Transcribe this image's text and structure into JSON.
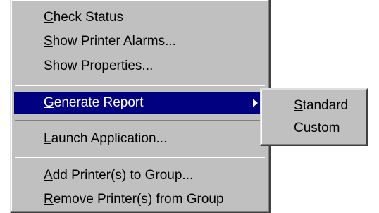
{
  "context_menu": {
    "items": [
      {
        "label": "Check Status",
        "accel": "C"
      },
      {
        "label": "Show Printer Alarms...",
        "accel": "S"
      },
      {
        "label": "Show Properties...",
        "accel": "P"
      },
      {
        "label": "Generate Report",
        "accel": "G",
        "selected": true,
        "has_submenu": true
      },
      {
        "label": "Launch Application...",
        "accel": "L"
      },
      {
        "label": "Add Printer(s) to Group...",
        "accel": "A"
      },
      {
        "label": "Remove Printer(s) from Group",
        "accel": "R"
      }
    ]
  },
  "submenu": {
    "items": [
      {
        "label": "Standard",
        "accel": "S"
      },
      {
        "label": "Custom",
        "accel": "C"
      }
    ]
  },
  "colors": {
    "menu_bg": "#c0c0c0",
    "highlight": "#000080",
    "highlight_text": "#ffffff"
  }
}
